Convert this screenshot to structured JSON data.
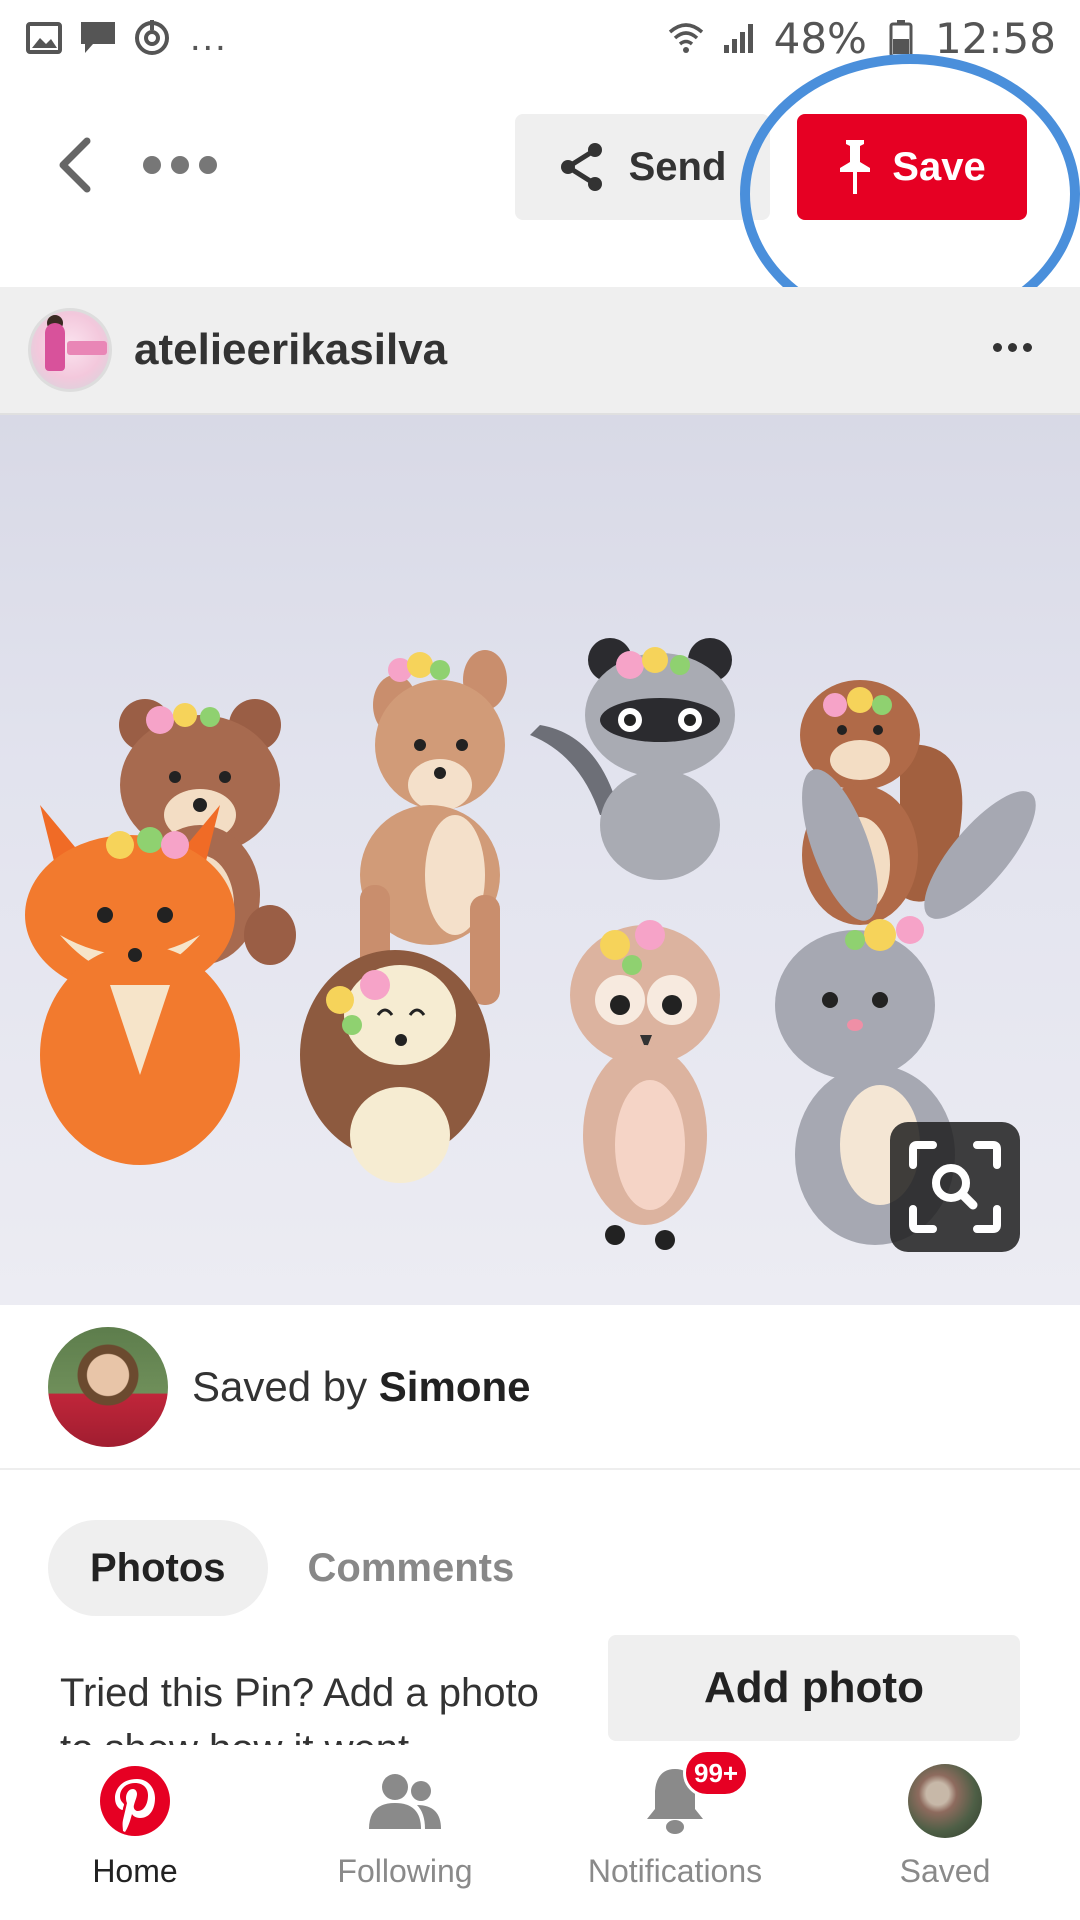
{
  "status_bar": {
    "battery": "48%",
    "time": "12:58",
    "ellipsis": "...",
    "icons": [
      "image-icon",
      "chat-icon",
      "sync-icon",
      "wifi-icon",
      "signal-icon",
      "battery-icon"
    ]
  },
  "top_bar": {
    "send_label": "Send",
    "save_label": "Save",
    "icons": [
      "back-chevron-icon",
      "more-dots-icon",
      "share-icon",
      "pin-icon"
    ]
  },
  "pin": {
    "author": "atelieerikasilva",
    "saved_by_prefix": "Saved by ",
    "saved_by_name": "Simone"
  },
  "tabs": [
    {
      "label": "Photos",
      "active": true
    },
    {
      "label": "Comments",
      "active": false
    }
  ],
  "tried": {
    "text": "Tried this Pin? Add a photo to show how it went",
    "button": "Add photo"
  },
  "bottom_nav": {
    "items": [
      {
        "label": "Home",
        "icon": "pinterest-logo-icon",
        "active": true
      },
      {
        "label": "Following",
        "icon": "people-icon",
        "active": false
      },
      {
        "label": "Notifications",
        "icon": "bell-icon",
        "active": false,
        "badge": "99+"
      },
      {
        "label": "Saved",
        "icon": "profile-avatar",
        "active": false
      }
    ]
  },
  "colors": {
    "brand_red": "#e60023",
    "highlight_ring": "#4a8fdb"
  }
}
